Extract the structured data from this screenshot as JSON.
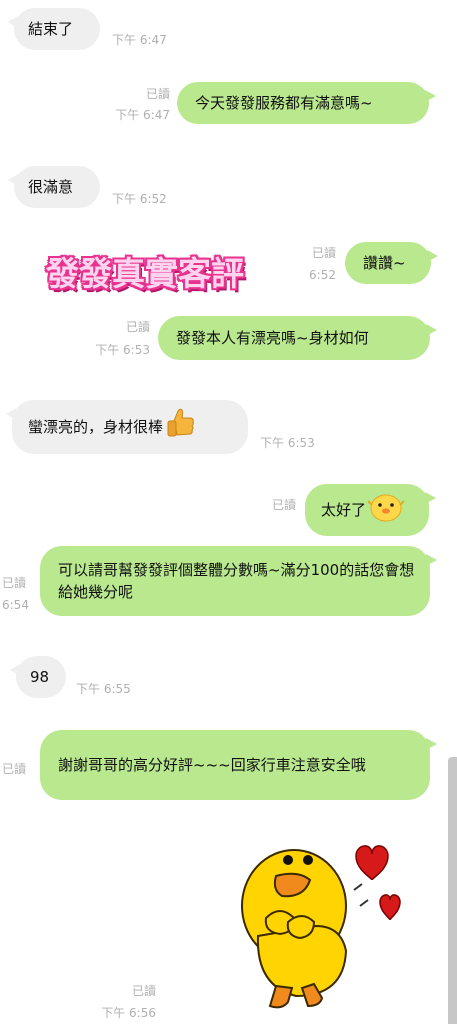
{
  "messages": [
    {
      "id": "m1",
      "side": "in",
      "text": "結束了",
      "time": "下午 6:47"
    },
    {
      "id": "m2",
      "side": "out",
      "text": "今天發發服務都有滿意嗎~",
      "read": "已讀",
      "time": "下午 6:47"
    },
    {
      "id": "m3",
      "side": "in",
      "text": "很滿意",
      "time": "下午 6:52"
    },
    {
      "id": "m4",
      "side": "out",
      "text": "讚讚~",
      "read": "已讀",
      "time": "6:52"
    },
    {
      "id": "m5",
      "side": "out",
      "text": "發發本人有漂亮嗎~身材如何",
      "read": "已讀",
      "time": "下午 6:53"
    },
    {
      "id": "m6",
      "side": "in",
      "text": "蠻漂亮的，身材很棒",
      "emoji": "thumbs-up",
      "time": "下午 6:53"
    },
    {
      "id": "m7",
      "side": "out",
      "text": "太好了",
      "emoji": "chick",
      "read": "已讀"
    },
    {
      "id": "m8",
      "side": "out",
      "text": "可以請哥幫發發評個整體分數嗎~滿分100的話您會想給她幾分呢",
      "read": "已讀",
      "time": "6:54"
    },
    {
      "id": "m9",
      "side": "in",
      "text": "98",
      "time": "下午 6:55"
    },
    {
      "id": "m10",
      "side": "out",
      "text": "謝謝哥哥的高分好評~~~回家行車注意安全哦",
      "read": "已讀"
    },
    {
      "id": "m11",
      "side": "out",
      "sticker": "sally-chick-hearts",
      "read": "已讀",
      "time": "下午 6:56"
    }
  ],
  "watermark": "發發真實客評",
  "colors": {
    "out_bubble": "#b9e88f",
    "in_bubble": "#efefef",
    "meta": "#b0b0b0",
    "watermark": "#e8338f"
  }
}
